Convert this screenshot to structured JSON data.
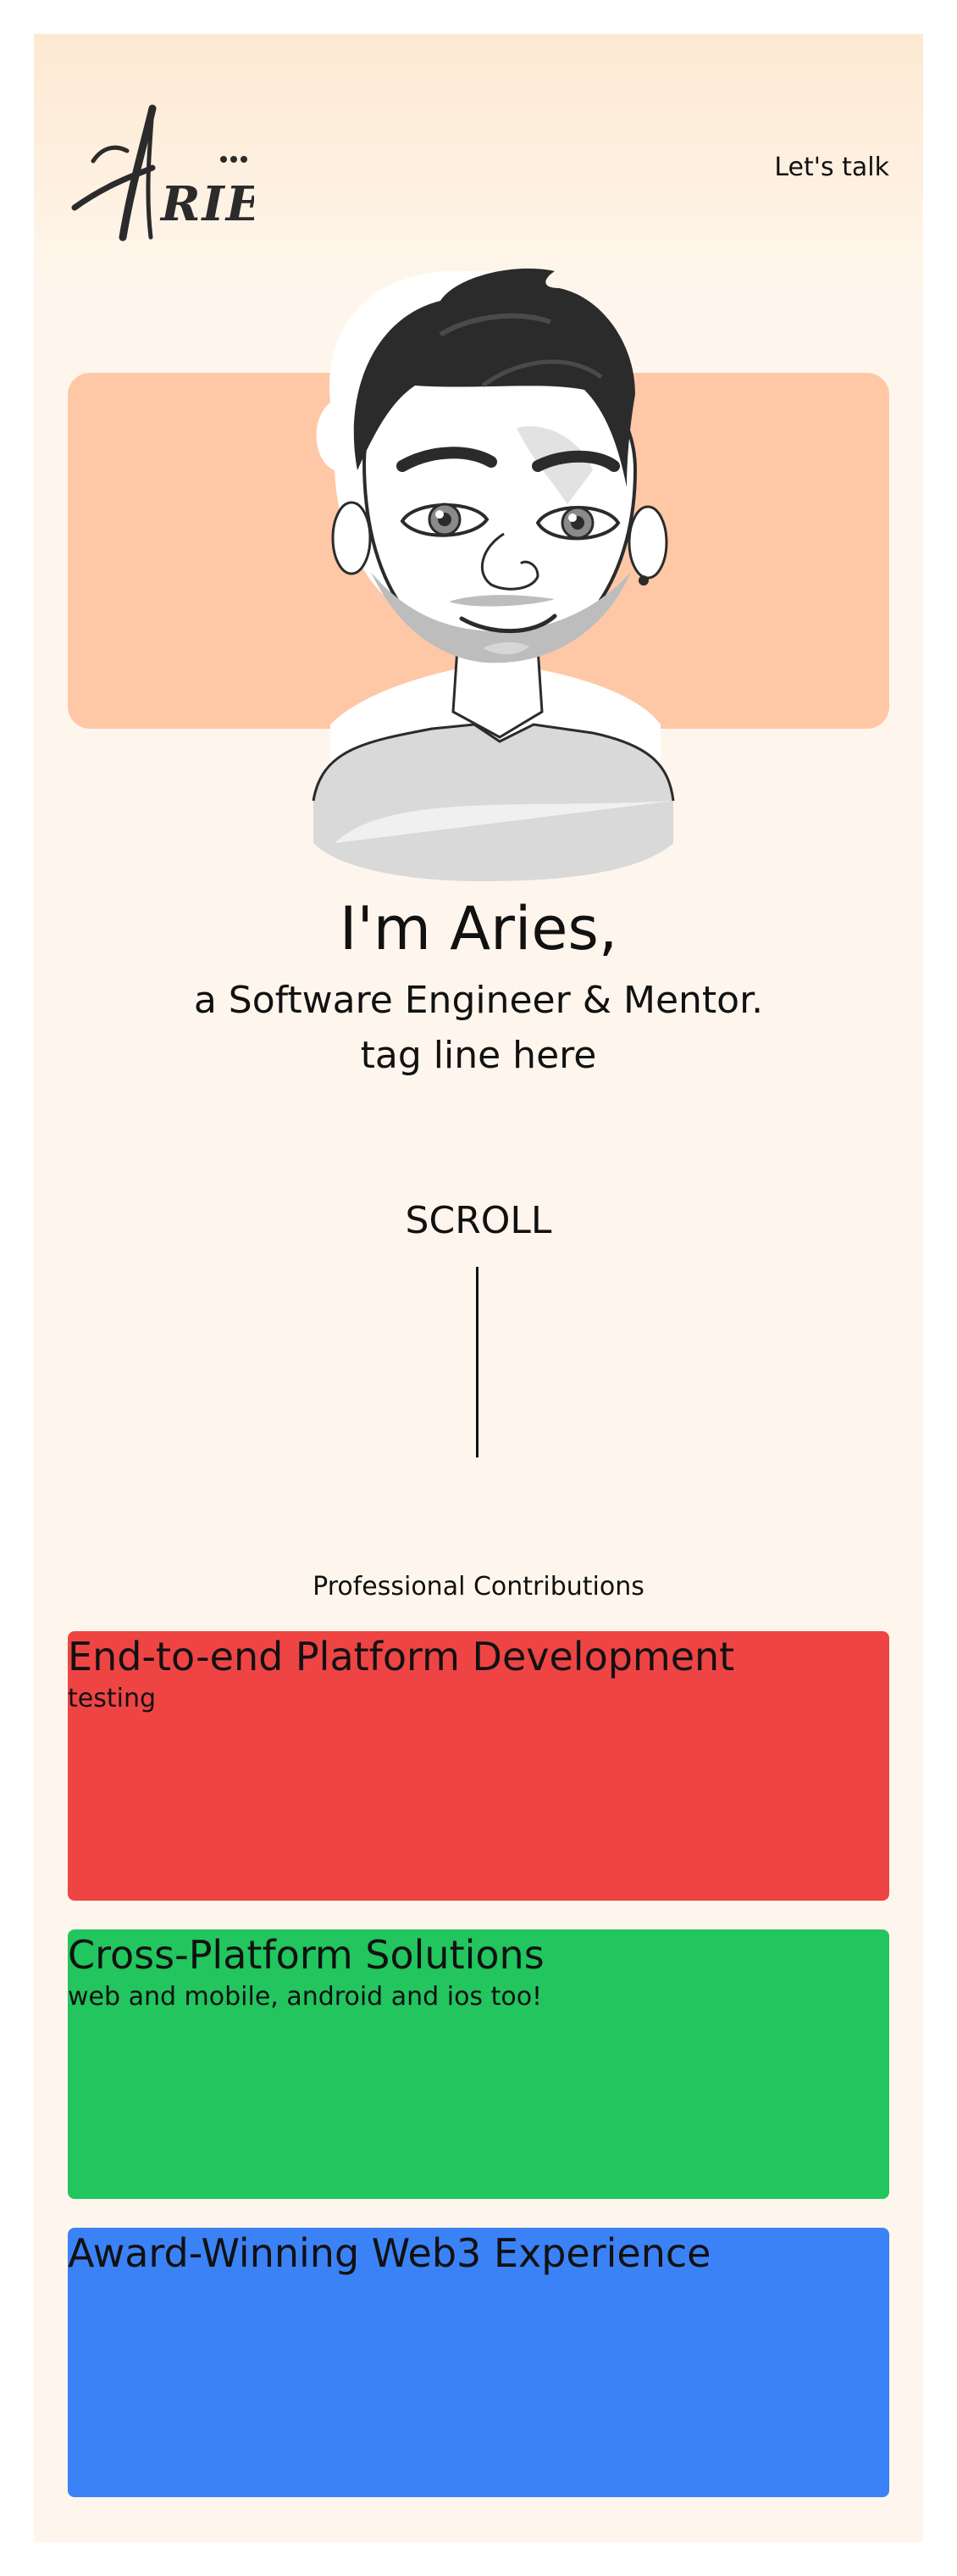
{
  "header": {
    "logo_text": "Aries",
    "nav_link": "Let's talk"
  },
  "hero": {
    "headline": "I'm Aries,",
    "subheadline": "a Software Engineer & Mentor.",
    "tagline": "tag line here",
    "accent_color": "#fec8a6"
  },
  "scroll": {
    "label": "SCROLL"
  },
  "contributions": {
    "section_title": "Professional Contributions",
    "cards": [
      {
        "title": "End-to-end Platform Development",
        "description": "testing",
        "color": "#ef4444"
      },
      {
        "title": "Cross-Platform Solutions",
        "description": "web and mobile, android and ios too!",
        "color": "#22c55e"
      },
      {
        "title": "Award-Winning Web3 Experience",
        "description": "",
        "color": "#3b82f6"
      }
    ]
  }
}
